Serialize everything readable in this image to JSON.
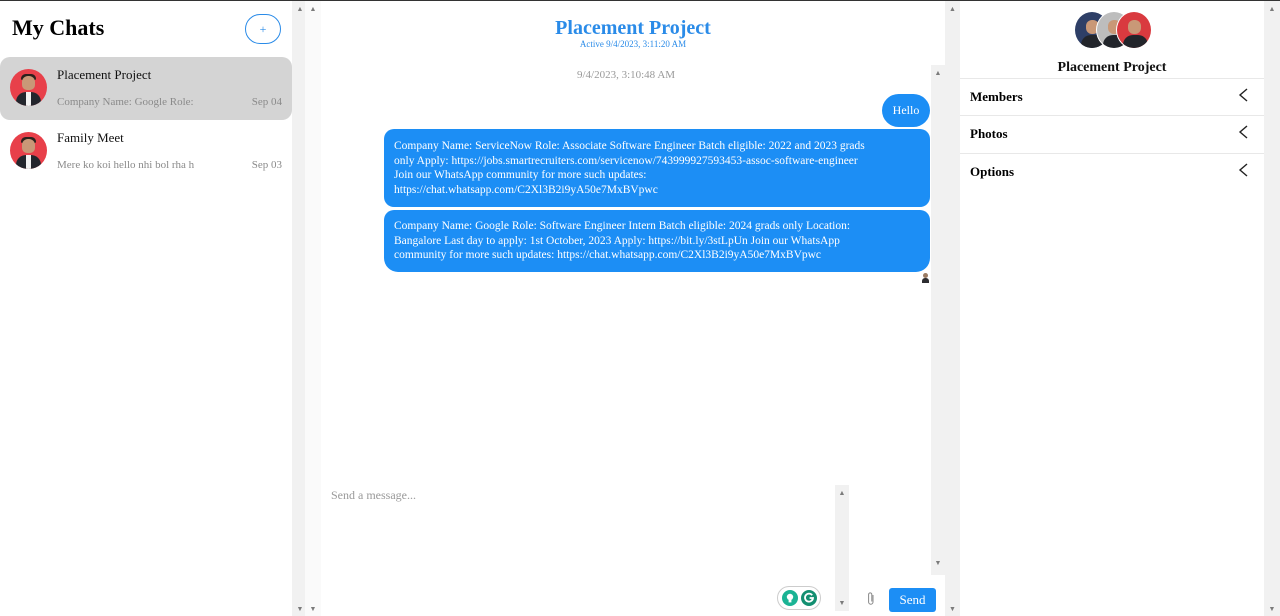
{
  "sidebar": {
    "title": "My Chats",
    "new_chat_label": "+",
    "chats": [
      {
        "name": "Placement Project",
        "preview": "Company Name: Google Role:",
        "date": "Sep 04",
        "active": true
      },
      {
        "name": "Family Meet",
        "preview": "Mere ko koi hello nhi bol rha h",
        "date": "Sep 03",
        "active": false
      }
    ]
  },
  "conversation": {
    "title": "Placement Project",
    "status": "Active 9/4/2023, 3:11:20 AM",
    "date_divider": "9/4/2023, 3:10:48 AM",
    "messages": [
      {
        "text": "Hello"
      },
      {
        "lines": [
          "Company Name: ServiceNow Role: Associate Software Engineer Batch eligible: 2022 and 2023 grads",
          "only Apply: https://jobs.smartrecruiters.com/servicenow/743999927593453-assoc-software-engineer",
          "Join our WhatsApp community for more such updates:",
          "https://chat.whatsapp.com/C2Xl3B2i9yA50e7MxBVpwc"
        ]
      },
      {
        "lines": [
          "Company Name: Google Role: Software Engineer Intern Batch eligible: 2024 grads only Location:",
          "Bangalore Last day to apply: 1st October, 2023 Apply: https://bit.ly/3stLpUn Join our WhatsApp",
          "community for more such updates: https://chat.whatsapp.com/C2Xl3B2i9yA50e7MxBVpwc"
        ]
      }
    ],
    "composer": {
      "placeholder": "Send a message...",
      "send_label": "Send"
    }
  },
  "details": {
    "group_name": "Placement Project",
    "sections": [
      {
        "label": "Members"
      },
      {
        "label": "Photos"
      },
      {
        "label": "Options"
      }
    ]
  },
  "colors": {
    "accent": "#2a8be8",
    "bubble": "#1c8ef5",
    "active_chat_bg": "#d4d4d4"
  }
}
